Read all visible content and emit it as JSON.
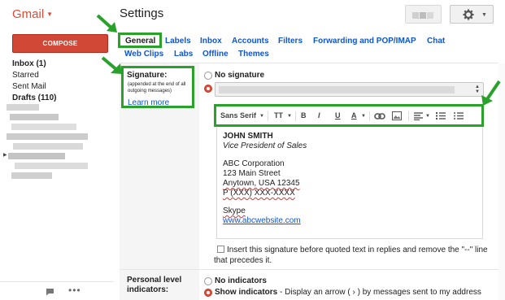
{
  "brand": {
    "name": "Gmail"
  },
  "header": {
    "title": "Settings"
  },
  "nav": {
    "compose_label": "COMPOSE",
    "items": [
      {
        "label": "Inbox (1)",
        "bold": true
      },
      {
        "label": "Starred",
        "bold": false
      },
      {
        "label": "Sent Mail",
        "bold": false
      },
      {
        "label": "Drafts (110)",
        "bold": true
      }
    ]
  },
  "tabs": [
    {
      "label": "General",
      "active": true
    },
    {
      "label": "Labels"
    },
    {
      "label": "Inbox"
    },
    {
      "label": "Accounts"
    },
    {
      "label": "Filters"
    },
    {
      "label": "Forwarding and POP/IMAP"
    },
    {
      "label": "Chat"
    },
    {
      "label": "Web Clips"
    },
    {
      "label": "Labs"
    },
    {
      "label": "Offline"
    },
    {
      "label": "Themes"
    }
  ],
  "signature": {
    "label": "Signature:",
    "note": "(appended at the end of all outgoing messages)",
    "learn_more": "Learn more",
    "no_signature_label": "No signature",
    "toolbar": {
      "font": "Sans Serif",
      "size_icon": "TT",
      "bold": "B",
      "italic": "I",
      "underline": "U",
      "text_color": "A"
    },
    "lines": [
      "JOHN SMITH",
      "Vice President of Sales",
      "",
      "ABC Corporation",
      "123 Main Street",
      "Anytown, USA 12345",
      "P (XXX) XXX-XXXX",
      "",
      "Skype",
      "www.abcwebsite.com"
    ],
    "quote_checkbox_label": "Insert this signature before quoted text in replies and remove the \"--\" line that precedes it."
  },
  "personal_level": {
    "label": "Personal level indicators:",
    "no_indicators": "No indicators",
    "show_indicators": "Show indicators",
    "show_indicators_desc": " - Display an arrow ( › ) by messages sent to my address"
  },
  "colors": {
    "brand_red": "#dd4b39",
    "compose_red": "#d14836",
    "link_blue": "#1155cc",
    "annotation_green": "#2aa12a"
  }
}
